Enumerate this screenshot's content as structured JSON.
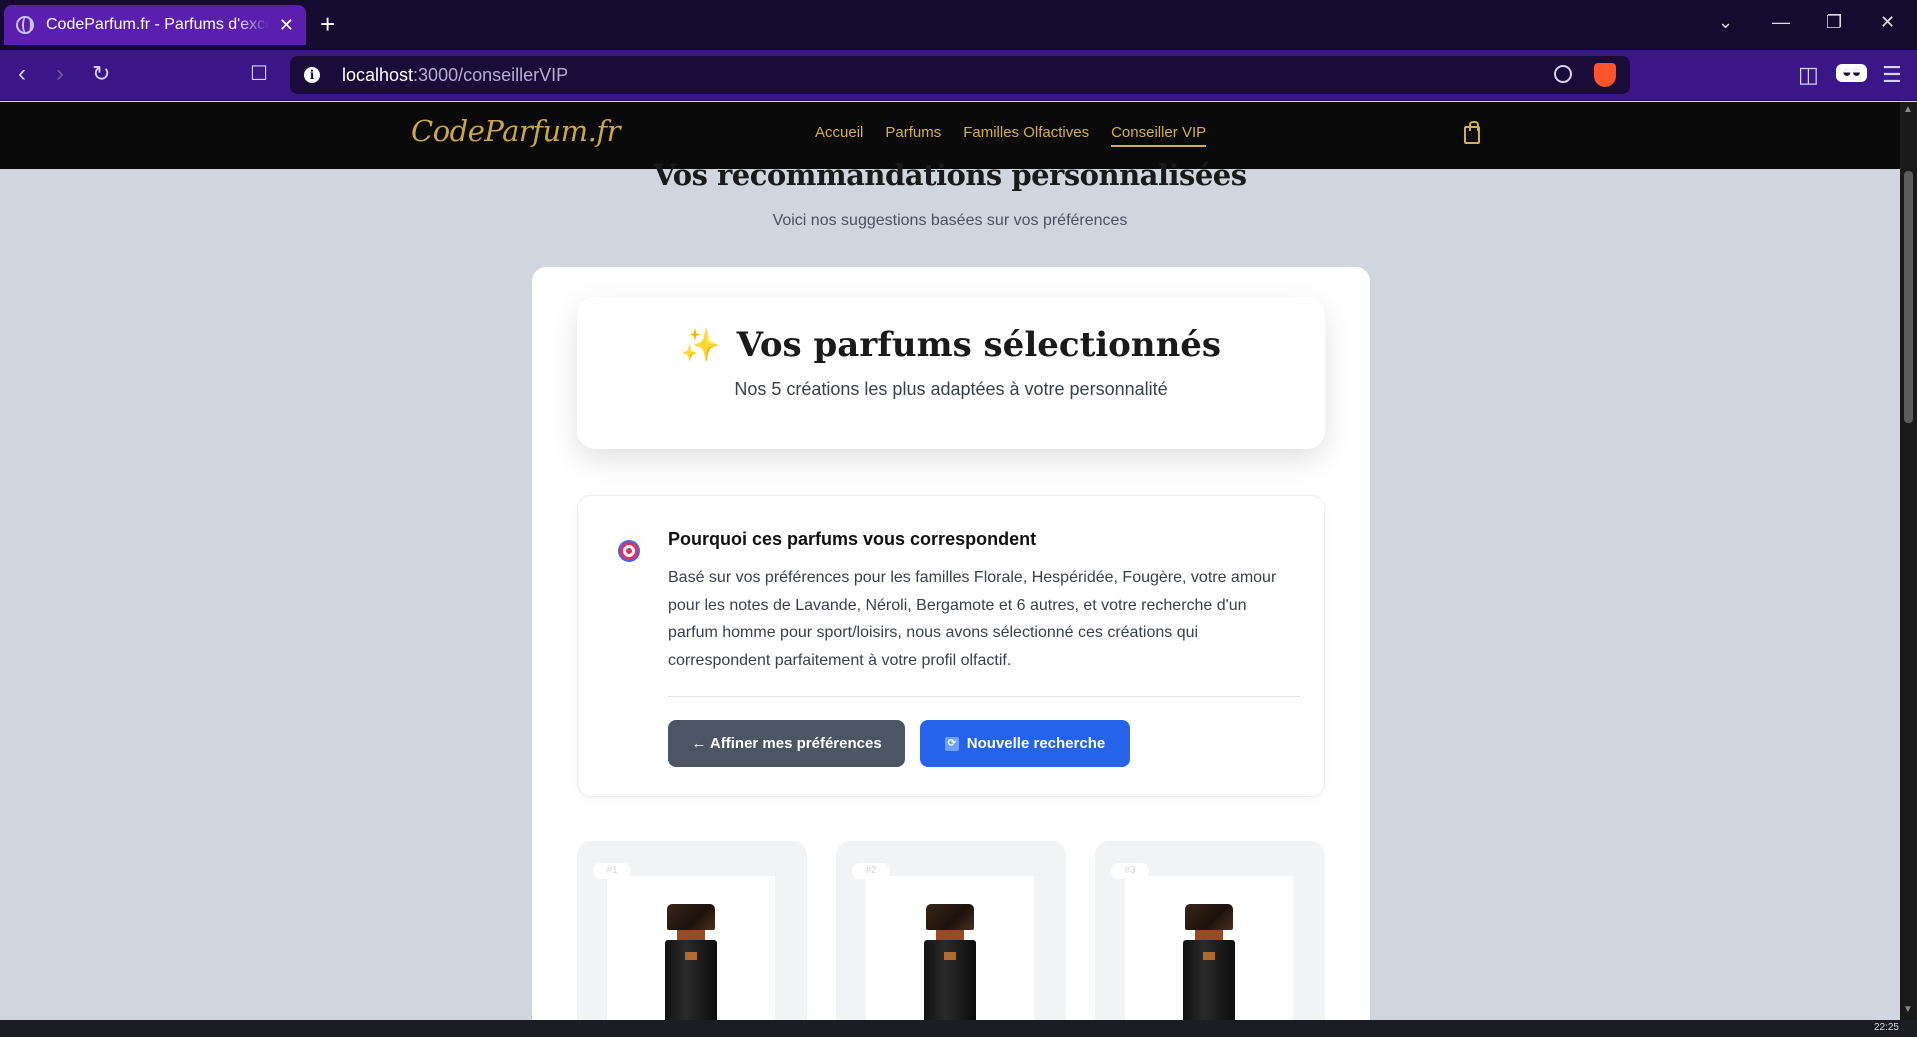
{
  "browser": {
    "tab_title": "CodeParfum.fr - Parfums d'exception",
    "url_host": "localhost",
    "url_path": ":3000/conseillerVIP"
  },
  "site": {
    "logo": "CodeParfum.fr",
    "nav": [
      {
        "label": "Accueil",
        "active": false
      },
      {
        "label": "Parfums",
        "active": false
      },
      {
        "label": "Familles Olfactives",
        "active": false
      },
      {
        "label": "Conseiller VIP",
        "active": true
      }
    ]
  },
  "page": {
    "heading": "Vos recommandations personnalisées",
    "subheading": "Voici nos suggestions basées sur vos préférences"
  },
  "hero": {
    "title": "Vos parfums sélectionnés",
    "subtitle": "Nos 5 créations les plus adaptées à votre personnalité"
  },
  "why": {
    "title": "Pourquoi ces parfums vous correspondent",
    "text": "Basé sur vos préférences pour les familles Florale, Hespéridée, Fougère, votre amour pour les notes de Lavande, Néroli, Bergamote et 6 autres, et votre recherche d'un parfum homme pour sport/loisirs, nous avons sélectionné ces créations qui correspondent parfaitement à votre profil olfactif.",
    "refine_label": "← Affiner mes préférences",
    "new_search_label": "Nouvelle recherche"
  },
  "products": [
    {
      "rank": "#1"
    },
    {
      "rank": "#2"
    },
    {
      "rank": "#3"
    }
  ],
  "colors": {
    "gold": "#d4b04a",
    "primary_blue": "#2563eb",
    "slate_button": "#4b5563",
    "browser_purple": "#5b1fb0"
  },
  "taskbar": {
    "time": "22:25"
  }
}
